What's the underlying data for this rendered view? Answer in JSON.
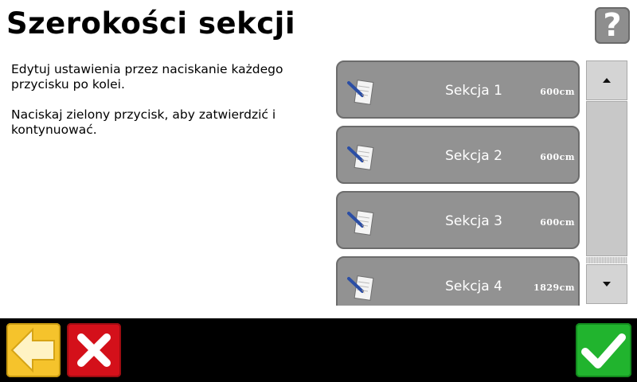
{
  "page": {
    "title": "Szerokości sekcji",
    "help_label": "?",
    "instructions": [
      "Edytuj ustawienia przez naciskanie każdego przycisku po kolei.",
      "Naciskaj zielony przycisk, aby zatwierdzić i kontynuować."
    ]
  },
  "sections": [
    {
      "label": "Sekcja 1",
      "value": "600cm"
    },
    {
      "label": "Sekcja 2",
      "value": "600cm"
    },
    {
      "label": "Sekcja 3",
      "value": "600cm"
    },
    {
      "label": "Sekcja 4",
      "value": "1829cm"
    }
  ],
  "icons": {
    "help": "question-icon",
    "section": "notepad-pencil-icon",
    "scroll_up": "arrow-up-icon",
    "scroll_down": "arrow-down-icon",
    "back": "arrow-left-icon",
    "cancel": "x-icon",
    "confirm": "checkmark-icon"
  },
  "colors": {
    "button_gray": "#929292",
    "back_yellow": "#f5c32c",
    "cancel_red": "#d4101a",
    "confirm_green": "#21b42e"
  }
}
